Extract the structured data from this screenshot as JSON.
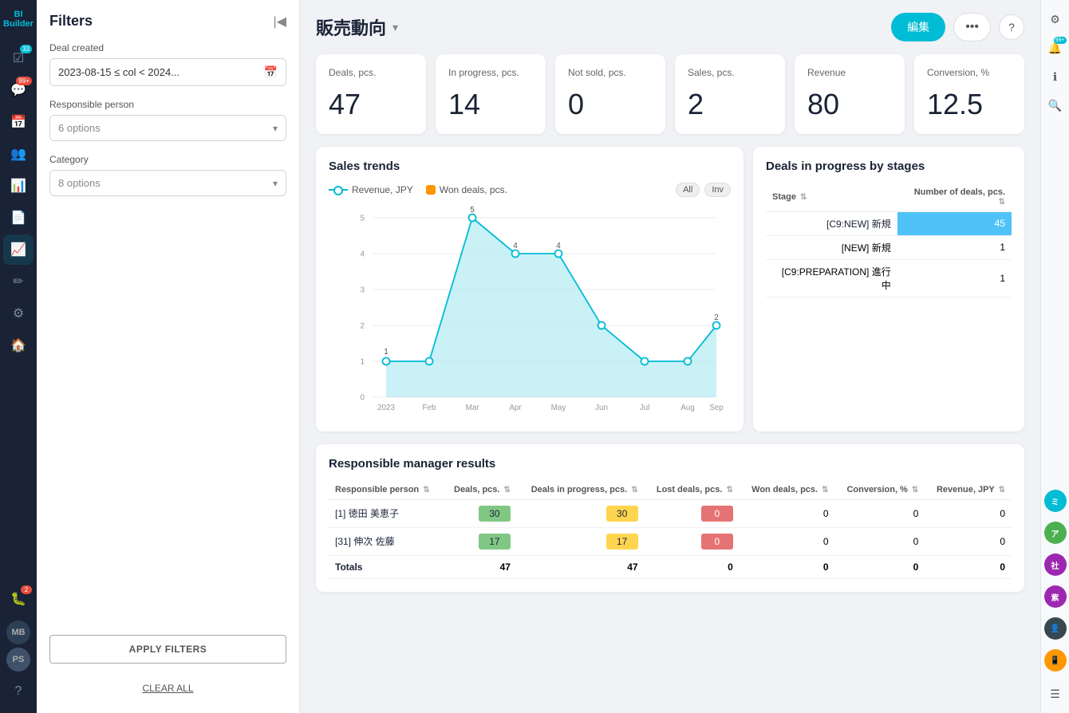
{
  "app": {
    "title": "BI Builder",
    "page_title": "販売動向"
  },
  "header": {
    "edit_label": "編集",
    "more_label": "•••",
    "help_label": "?"
  },
  "filters": {
    "title": "Filters",
    "deal_created_label": "Deal created",
    "deal_created_value": "2023-08-15 ≤ col < 2024...",
    "responsible_person_label": "Responsible person",
    "responsible_person_placeholder": "6 options",
    "category_label": "Category",
    "category_placeholder": "8 options",
    "apply_label": "APPLY FILTERS",
    "clear_label": "CLEAR ALL"
  },
  "kpis": [
    {
      "label": "Deals, pcs.",
      "value": "47"
    },
    {
      "label": "In progress, pcs.",
      "value": "14"
    },
    {
      "label": "Not sold, pcs.",
      "value": "0"
    },
    {
      "label": "Sales, pcs.",
      "value": "2"
    },
    {
      "label": "Revenue",
      "value": "80"
    },
    {
      "label": "Conversion, %",
      "value": "12.5"
    }
  ],
  "sales_trends": {
    "title": "Sales trends",
    "legend": {
      "line_label": "Revenue, JPY",
      "bar_label": "Won deals, pcs.",
      "filter_all": "All",
      "filter_inv": "Inv"
    },
    "x_labels": [
      "2023",
      "Feb",
      "Mar",
      "Apr",
      "May",
      "Jun",
      "Jul",
      "Aug",
      "Sep"
    ],
    "y_labels": [
      "0",
      "1",
      "2",
      "3",
      "4",
      "5"
    ],
    "data_points": [
      1,
      1,
      5,
      4,
      4,
      2,
      1,
      1,
      2
    ],
    "data_labels": [
      "1",
      "",
      "5",
      "4",
      "4",
      "",
      "",
      "",
      "2"
    ]
  },
  "stages_table": {
    "title": "Deals in progress by stages",
    "col_stage": "Stage",
    "col_deals": "Number of deals, pcs.",
    "rows": [
      {
        "stage": "[C9:NEW] 新規",
        "deals": "45",
        "highlighted": true
      },
      {
        "stage": "[NEW] 新規",
        "deals": "1",
        "highlighted": false
      },
      {
        "stage": "[C9:PREPARATION] 進行中",
        "deals": "1",
        "highlighted": false
      }
    ]
  },
  "manager_results": {
    "title": "Responsible manager results",
    "columns": [
      "Responsible person",
      "Deals, pcs.",
      "Deals in progress, pcs.",
      "Lost deals, pcs.",
      "Won deals, pcs.",
      "Conversion, %",
      "Revenue, JPY"
    ],
    "rows": [
      {
        "person": "[1] 徳田 美恵子",
        "deals": 30,
        "in_progress": 30,
        "lost": 0,
        "won": 0,
        "conversion": 0,
        "revenue": 0,
        "deals_color": "green",
        "progress_color": "yellow",
        "lost_color": "red"
      },
      {
        "person": "[31] 伸次 佐藤",
        "deals": 17,
        "in_progress": 17,
        "lost": 0,
        "won": 0,
        "conversion": 0,
        "revenue": 0,
        "deals_color": "green",
        "progress_color": "yellow",
        "lost_color": "red"
      }
    ],
    "totals": {
      "label": "Totals",
      "deals": 47,
      "in_progress": 47,
      "lost": 0,
      "won": 0,
      "conversion": 0,
      "revenue": 0
    }
  },
  "nav": {
    "items": [
      {
        "icon": "☑",
        "badge": "33",
        "badge_color": "teal"
      },
      {
        "icon": "💬",
        "badge": "99+",
        "badge_color": "red"
      },
      {
        "icon": "📅",
        "badge": null
      },
      {
        "icon": "👥",
        "badge": null
      },
      {
        "icon": "📊",
        "badge": null
      },
      {
        "icon": "📄",
        "badge": null
      },
      {
        "icon": "📈",
        "badge": null,
        "active": true
      },
      {
        "icon": "✏",
        "badge": null
      },
      {
        "icon": "🔧",
        "badge": null
      },
      {
        "icon": "🏠",
        "badge": null
      },
      {
        "icon": "🐛",
        "badge": "2",
        "badge_color": "red"
      }
    ],
    "bottom_items": [
      "MB",
      "PS",
      "?",
      "⚙"
    ]
  },
  "right_rail": {
    "icons": [
      {
        "symbol": "⚙",
        "badge": null
      },
      {
        "symbol": "🔔",
        "badge": "99+",
        "badge_color": "teal"
      },
      {
        "symbol": "ℹ",
        "badge": null
      },
      {
        "symbol": "🔍",
        "badge": null
      }
    ],
    "avatars": [
      {
        "initials": "ミ",
        "color": "teal"
      },
      {
        "initials": "ア",
        "color": "green"
      },
      {
        "initials": "社",
        "color": "purple"
      },
      {
        "initials": "紫",
        "color": "purple"
      },
      {
        "initials": "👤",
        "color": "blue"
      },
      {
        "initials": "📱",
        "color": "orange"
      }
    ]
  }
}
